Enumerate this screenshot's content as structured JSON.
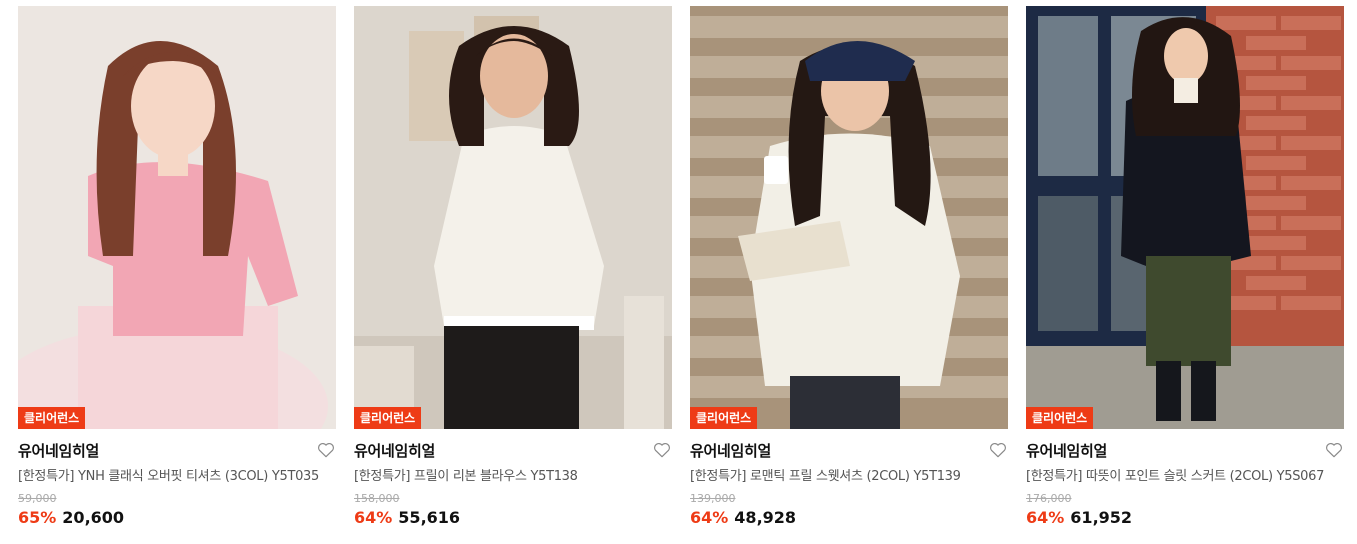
{
  "colors": {
    "accent": "#ee3b16",
    "text": "#111111",
    "muted": "#555555",
    "strike": "#aaaaaa"
  },
  "products": [
    {
      "badge": "클리어런스",
      "brand": "유어네임히얼",
      "name": "[한정특가] YNH 클래식 오버핏 티셔츠 (3COL) Y5T035",
      "original_price": "59,000",
      "discount": "65%",
      "price": "20,600",
      "image": "model-pink-tshirt"
    },
    {
      "badge": "클리어런스",
      "brand": "유어네임히얼",
      "name": "[한정특가] 프릴이 리본 블라우스 Y5T138",
      "original_price": "158,000",
      "discount": "64%",
      "price": "55,616",
      "image": "model-white-blouse"
    },
    {
      "badge": "클리어런스",
      "brand": "유어네임히얼",
      "name": "[한정특가] 로맨틱 프릴 스웻셔츠 (2COL) Y5T139",
      "original_price": "139,000",
      "discount": "64%",
      "price": "48,928",
      "image": "model-ivory-sweatshirt"
    },
    {
      "badge": "클리어런스",
      "brand": "유어네임히얼",
      "name": "[한정특가] 따뜻이 포인트 슬릿 스커트 (2COL) Y5S067",
      "original_price": "176,000",
      "discount": "64%",
      "price": "61,952",
      "image": "model-check-skirt"
    }
  ]
}
